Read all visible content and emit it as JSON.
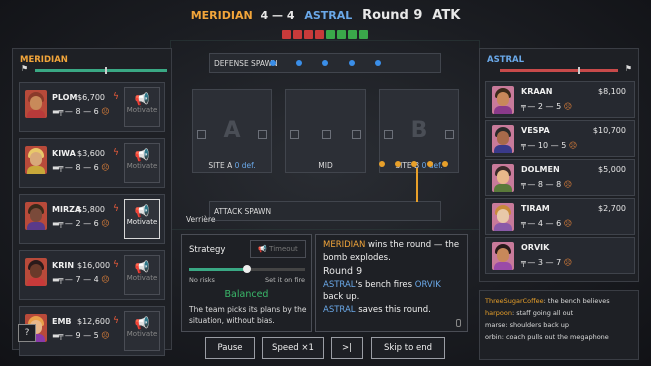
{
  "header": {
    "team_left": "MERIDIAN",
    "score": "4 — 4",
    "team_right": "ASTRAL",
    "round": "Round 9",
    "side": "ATK",
    "round_history": [
      "loss",
      "loss",
      "loss",
      "loss",
      "win",
      "win",
      "win",
      "win"
    ]
  },
  "colors": {
    "meridian": "#f2a53a",
    "astral": "#6aa8e8",
    "win": "#3aa84a",
    "loss": "#c83a3a"
  },
  "left_team": {
    "name": "MERIDIAN",
    "players": [
      {
        "name": "PLOM",
        "money": "$6,700",
        "kills": "8",
        "deaths": "6",
        "motivate": "Motivate",
        "active": false
      },
      {
        "name": "KIWA",
        "money": "$3,600",
        "kills": "8",
        "deaths": "6",
        "motivate": "Motivate",
        "active": false
      },
      {
        "name": "MIRZA",
        "money": "$5,800",
        "kills": "2",
        "deaths": "6",
        "motivate": "Motivate",
        "active": true
      },
      {
        "name": "KRIN",
        "money": "$16,000",
        "kills": "7",
        "deaths": "4",
        "motivate": "Motivate",
        "active": false
      },
      {
        "name": "EMB",
        "money": "$12,600",
        "kills": "9",
        "deaths": "5",
        "motivate": "Motivate",
        "active": false
      }
    ],
    "help_label": "?"
  },
  "right_team": {
    "name": "ASTRAL",
    "players": [
      {
        "name": "KRAAN",
        "money": "$8,100",
        "kills": "2",
        "deaths": "5"
      },
      {
        "name": "VESPA",
        "money": "$10,700",
        "kills": "10",
        "deaths": "5"
      },
      {
        "name": "DOLMEN",
        "money": "$5,000",
        "kills": "8",
        "deaths": "8"
      },
      {
        "name": "TIRAM",
        "money": "$2,700",
        "kills": "4",
        "deaths": "6"
      },
      {
        "name": "ORVIK",
        "money": "",
        "kills": "3",
        "deaths": "7"
      }
    ]
  },
  "map": {
    "defense_spawn": "DEFENSE SPAWN",
    "attack_spawn": "ATTACK SPAWN",
    "site_a": "SITE A",
    "site_a_def": "0 def.",
    "mid": "MID",
    "site_b": "SITE B",
    "site_b_def": "0 def.",
    "letter_a": "A",
    "letter_b": "B",
    "verriere": "Verrière"
  },
  "strategy": {
    "title": "Strategy",
    "timeout_label": "Timeout",
    "risk_level": 0.5,
    "low_label": "No risks",
    "high_label": "Set it on fire",
    "mode": "Balanced",
    "description": "The team picks its plans by the situation, without bias."
  },
  "log": {
    "line1_team": "MERIDIAN",
    "line1_text": " wins the round — the bomb explodes.",
    "round": "Round 9",
    "line2_team": "ASTRAL",
    "line2_mid": "'s bench fires ",
    "line2_player": "ORVIK",
    "line2_end": " back up.",
    "line3_team": "ASTRAL",
    "line3_text": " saves this round."
  },
  "chat": [
    {
      "user": "ThreeSugarCoffee",
      "text": ": the bench believes"
    },
    {
      "user": "harpoon",
      "text": ": staff going all out"
    },
    {
      "user": "marse",
      "text": ": shoulders back up"
    },
    {
      "user": "orbin",
      "text": ": coach pulls out the megaphone"
    }
  ],
  "controls": {
    "pause": "Pause",
    "speed": "Speed ×1",
    "step": ">|",
    "skip": "Skip to end"
  }
}
